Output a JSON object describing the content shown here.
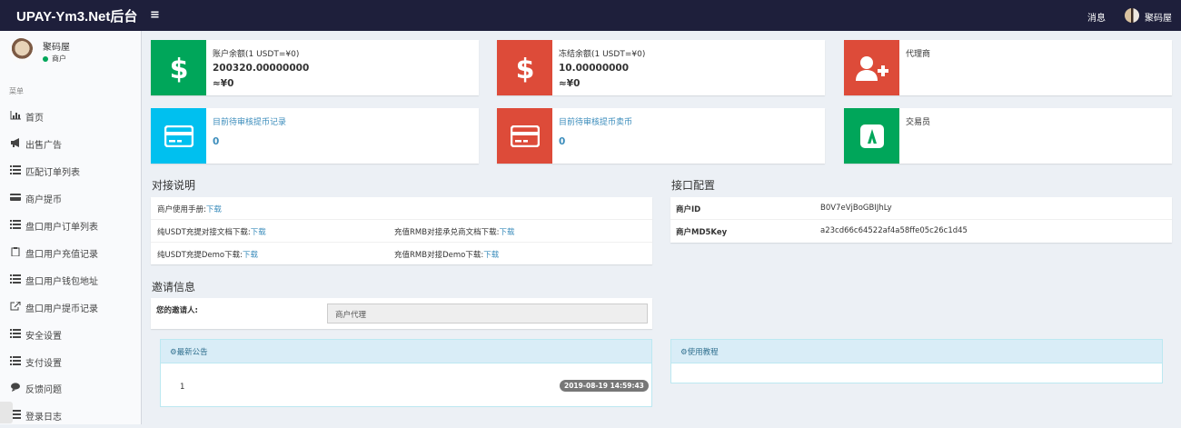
{
  "header": {
    "logo": "UPAY-Ym3.Net后台",
    "menu_toggle": "≡",
    "messages": "消息",
    "user": "聚码屋"
  },
  "sidebar": {
    "user_name": "聚码屋",
    "user_status": "商户",
    "menu_header": "菜单",
    "items": [
      {
        "label": "首页",
        "icon": "bar-chart-icon"
      },
      {
        "label": "出售广告",
        "icon": "bullhorn-icon"
      },
      {
        "label": "匹配订单列表",
        "icon": "list-icon"
      },
      {
        "label": "商户提币",
        "icon": "credit-card-icon"
      },
      {
        "label": "盘口用户订单列表",
        "icon": "list-icon"
      },
      {
        "label": "盘口用户充值记录",
        "icon": "clipboard-icon"
      },
      {
        "label": "盘口用户钱包地址",
        "icon": "list-icon"
      },
      {
        "label": "盘口用户提币记录",
        "icon": "external-link-icon"
      },
      {
        "label": "安全设置",
        "icon": "list-icon"
      },
      {
        "label": "支付设置",
        "icon": "list-icon"
      },
      {
        "label": "反馈问题",
        "icon": "comment-icon"
      },
      {
        "label": "登录日志",
        "icon": "list-icon"
      }
    ]
  },
  "info_boxes": {
    "balance": {
      "title": "账户余额(1 USDT=¥0)",
      "value": "200320.00000000",
      "cny": "≈¥0",
      "icon": "dollar-icon",
      "color": "#00a65a"
    },
    "frozen": {
      "title": "冻结余额(1 USDT=¥0)",
      "value": "10.00000000",
      "cny": "≈¥0",
      "icon": "dollar-icon",
      "color": "#dd4b39"
    },
    "agent": {
      "title": "代理商",
      "icon": "user-plus-icon",
      "color": "#dd4b39"
    },
    "pending_withdraw": {
      "title": "目前待审核提币记录",
      "value": "0",
      "icon": "credit-card-icon",
      "color": "#00c0ef"
    },
    "pending_sell": {
      "title": "目前待审核提币卖币",
      "value": "0",
      "icon": "credit-card-icon",
      "color": "#dd4b39"
    },
    "trader": {
      "title": "交易员",
      "icon": "a-logo-icon",
      "color": "#00a65a"
    }
  },
  "integration": {
    "title": "对接说明",
    "manual_label": "商户使用手册:",
    "download": "下载",
    "usdt_doc_label": "纯USDT充提对接文档下载:",
    "rmb_doc_label": "充值RMB对接承兑商文档下载:",
    "usdt_demo_label": "纯USDT充提Demo下载:",
    "rmb_demo_label": "充值RMB对接Demo下载:"
  },
  "api_config": {
    "title": "接口配置",
    "merchant_id_label": "商户ID",
    "merchant_id_value": "B0V7eVjBoGBIJhLy",
    "md5_label": "商户MD5Key",
    "md5_value": "a23cd66c64522af4a58ffe05c26c1d45"
  },
  "invite": {
    "title": "邀请信息",
    "inviter_label": "您的邀请人:",
    "inviter_value": "商户代理"
  },
  "announcements": {
    "title": "最新公告",
    "items": [
      {
        "title": "1",
        "time": "2019-08-19 14:59:43"
      }
    ]
  },
  "tutorial": {
    "title": "使用教程"
  }
}
